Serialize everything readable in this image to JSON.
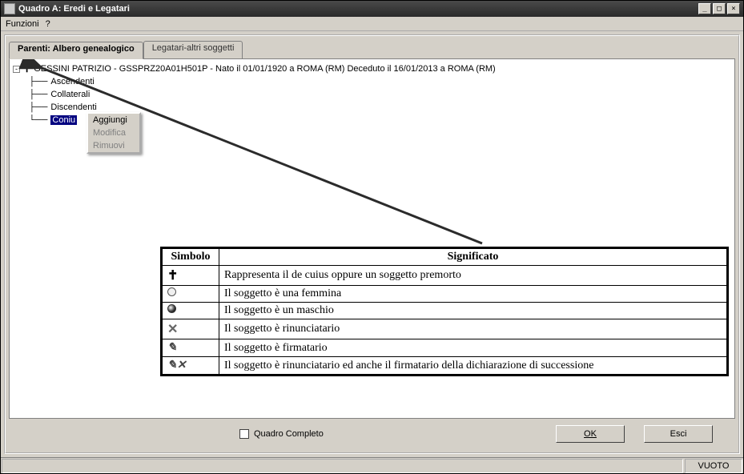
{
  "window": {
    "title": "Quadro A: Eredi e Legatari"
  },
  "menu": {
    "funzioni": "Funzioni",
    "help": "?"
  },
  "tabs": {
    "parenti": "Parenti: Albero genealogico",
    "legatari": "Legatari-altri soggetti"
  },
  "tree": {
    "root": "GESSINI PATRIZIO - GSSPRZ20A01H501P -  Nato il 01/01/1920 a ROMA (RM) Deceduto il 16/01/2013 a ROMA (RM)",
    "children": [
      "Ascendenti",
      "Collaterali",
      "Discendenti",
      "Coniu"
    ]
  },
  "context": {
    "aggiungi": "Aggiungi",
    "modifica": "Modifica",
    "rimuovi": "Rimuovi"
  },
  "legend": {
    "headers": {
      "simbolo": "Simbolo",
      "significato": "Significato"
    },
    "rows": [
      {
        "sym": "cross",
        "text": "Rappresenta il de cuius oppure un soggetto premorto"
      },
      {
        "sym": "circle-empty",
        "text": "Il soggetto è una femmina"
      },
      {
        "sym": "circle-filled",
        "text": "Il soggetto è un maschio"
      },
      {
        "sym": "x",
        "text": "Il soggetto è rinunciatario"
      },
      {
        "sym": "pen",
        "text": "Il soggetto è firmatario"
      },
      {
        "sym": "penx",
        "text": "Il soggetto è rinunciatario ed anche il firmatario della dichiarazione di successione"
      }
    ]
  },
  "bottom": {
    "checkbox": "Quadro Completo",
    "ok": "OK",
    "esci": "Esci"
  },
  "status": {
    "right": "VUOTO"
  }
}
